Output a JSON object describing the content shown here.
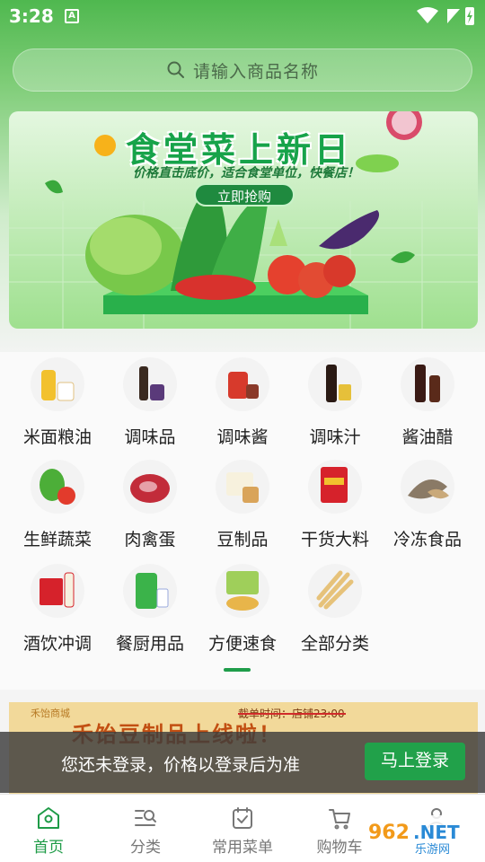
{
  "status": {
    "time": "3:28",
    "notif_glyph": "A"
  },
  "search": {
    "placeholder": "请输入商品名称"
  },
  "banner": {
    "title": "食堂菜上新日",
    "subtitle": "价格直击底价，适合食堂单位，快餐店！",
    "button": "立即抢购"
  },
  "categories": [
    {
      "label": "米面粮油",
      "icon": "grain-oil-icon"
    },
    {
      "label": "调味品",
      "icon": "seasoning-icon"
    },
    {
      "label": "调味酱",
      "icon": "sauce-jar-icon"
    },
    {
      "label": "调味汁",
      "icon": "sauce-bottle-icon"
    },
    {
      "label": "酱油醋",
      "icon": "soy-vinegar-icon"
    },
    {
      "label": "生鲜蔬菜",
      "icon": "vegetable-icon"
    },
    {
      "label": "肉禽蛋",
      "icon": "meat-icon"
    },
    {
      "label": "豆制品",
      "icon": "tofu-icon"
    },
    {
      "label": "干货大料",
      "icon": "dried-goods-icon"
    },
    {
      "label": "冷冻食品",
      "icon": "frozen-food-icon"
    },
    {
      "label": "酒饮冲调",
      "icon": "liquor-icon"
    },
    {
      "label": "餐厨用品",
      "icon": "kitchen-supplies-icon"
    },
    {
      "label": "方便速食",
      "icon": "instant-food-icon"
    },
    {
      "label": "全部分类",
      "icon": "all-categories-icon"
    }
  ],
  "promo": {
    "brand": "禾饴商城",
    "time": "截单时间：店铺23:00",
    "title": "禾饴豆制品上线啦！"
  },
  "login_bar": {
    "message": "您还未登录，价格以登录后为准",
    "button": "马上登录"
  },
  "tabs": [
    {
      "label": "首页",
      "active": true
    },
    {
      "label": "分类",
      "active": false
    },
    {
      "label": "常用菜单",
      "active": false
    },
    {
      "label": "购物车",
      "active": false
    }
  ],
  "colors": {
    "accent": "#1e9b47",
    "header_green": "#4fb84f",
    "login_button": "#21a14a"
  }
}
